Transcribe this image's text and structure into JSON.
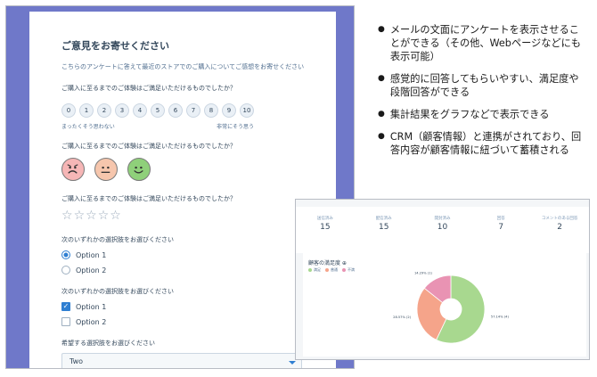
{
  "survey": {
    "title": "ご意見をお寄せください",
    "intro": "こちらのアンケートに答えて最近のストアでのご購入についてご感想をお寄せください",
    "q1": "ご購入に至るまでのご体験はご満足いただけるものでしたか？",
    "nps": [
      "0",
      "1",
      "2",
      "3",
      "4",
      "5",
      "6",
      "7",
      "8",
      "9",
      "10"
    ],
    "nps_low": "まったくそう思わない",
    "nps_high": "非常にそう思う",
    "q2": "ご購入に至るまでのご体験はご満足いただけるものでしたか？",
    "faces": [
      {
        "mood": "sad",
        "color": "#f6b6b6"
      },
      {
        "mood": "neutral",
        "color": "#f6c6ad"
      },
      {
        "mood": "happy",
        "color": "#8fd07a"
      }
    ],
    "q3": "ご購入に至るまでのご体験はご満足いただけるものでしたか？",
    "stars": [
      "☆",
      "☆",
      "☆",
      "☆",
      "☆"
    ],
    "q4": "次のいずれかの選択肢をお選びください",
    "radio_options": [
      {
        "label": "Option 1",
        "selected": true
      },
      {
        "label": "Option 2",
        "selected": false
      }
    ],
    "q5": "次のいずれかの選択肢をお選びください",
    "check_options": [
      {
        "label": "Option 1",
        "checked": true
      },
      {
        "label": "Option 2",
        "checked": false
      }
    ],
    "q6": "希望する選択肢をお選びください",
    "dropdown_value": "Two",
    "check_mark": "✓"
  },
  "bullets": [
    "メールの文面にアンケートを表示させることができる（その他、Webページなどにも表示可能）",
    "感覚的に回答してもらいやすい、満足度や段階回答ができる",
    "集計結果をグラフなどで表示できる",
    "CRM（顧客情報）と連携がされており、回答内容が顧客情報に紐づいて蓄積される"
  ],
  "bullet_symbol": "●",
  "report": {
    "stats": [
      {
        "label": "送信済み",
        "value": "15"
      },
      {
        "label": "配信済み",
        "value": "15"
      },
      {
        "label": "開封済み",
        "value": "10"
      },
      {
        "label": "回答",
        "value": "7"
      },
      {
        "label": "コメントのある回答",
        "value": "2"
      }
    ],
    "panel_title": "顧客の満足度 ⊕",
    "legend": [
      {
        "label": "満足",
        "color": "#a8d88f"
      },
      {
        "label": "普通",
        "color": "#f5a48a"
      },
      {
        "label": "不満",
        "color": "#e993b3"
      }
    ]
  },
  "chart_data": {
    "type": "pie",
    "donut": true,
    "categories": [
      "満足",
      "普通",
      "不満"
    ],
    "values": [
      57.1,
      28.6,
      14.3
    ],
    "colors": [
      "#a8d88f",
      "#f5a48a",
      "#e993b3"
    ],
    "data_labels": [
      "57.14% (4)",
      "28.57% (2)",
      "14.29% (1)"
    ]
  }
}
